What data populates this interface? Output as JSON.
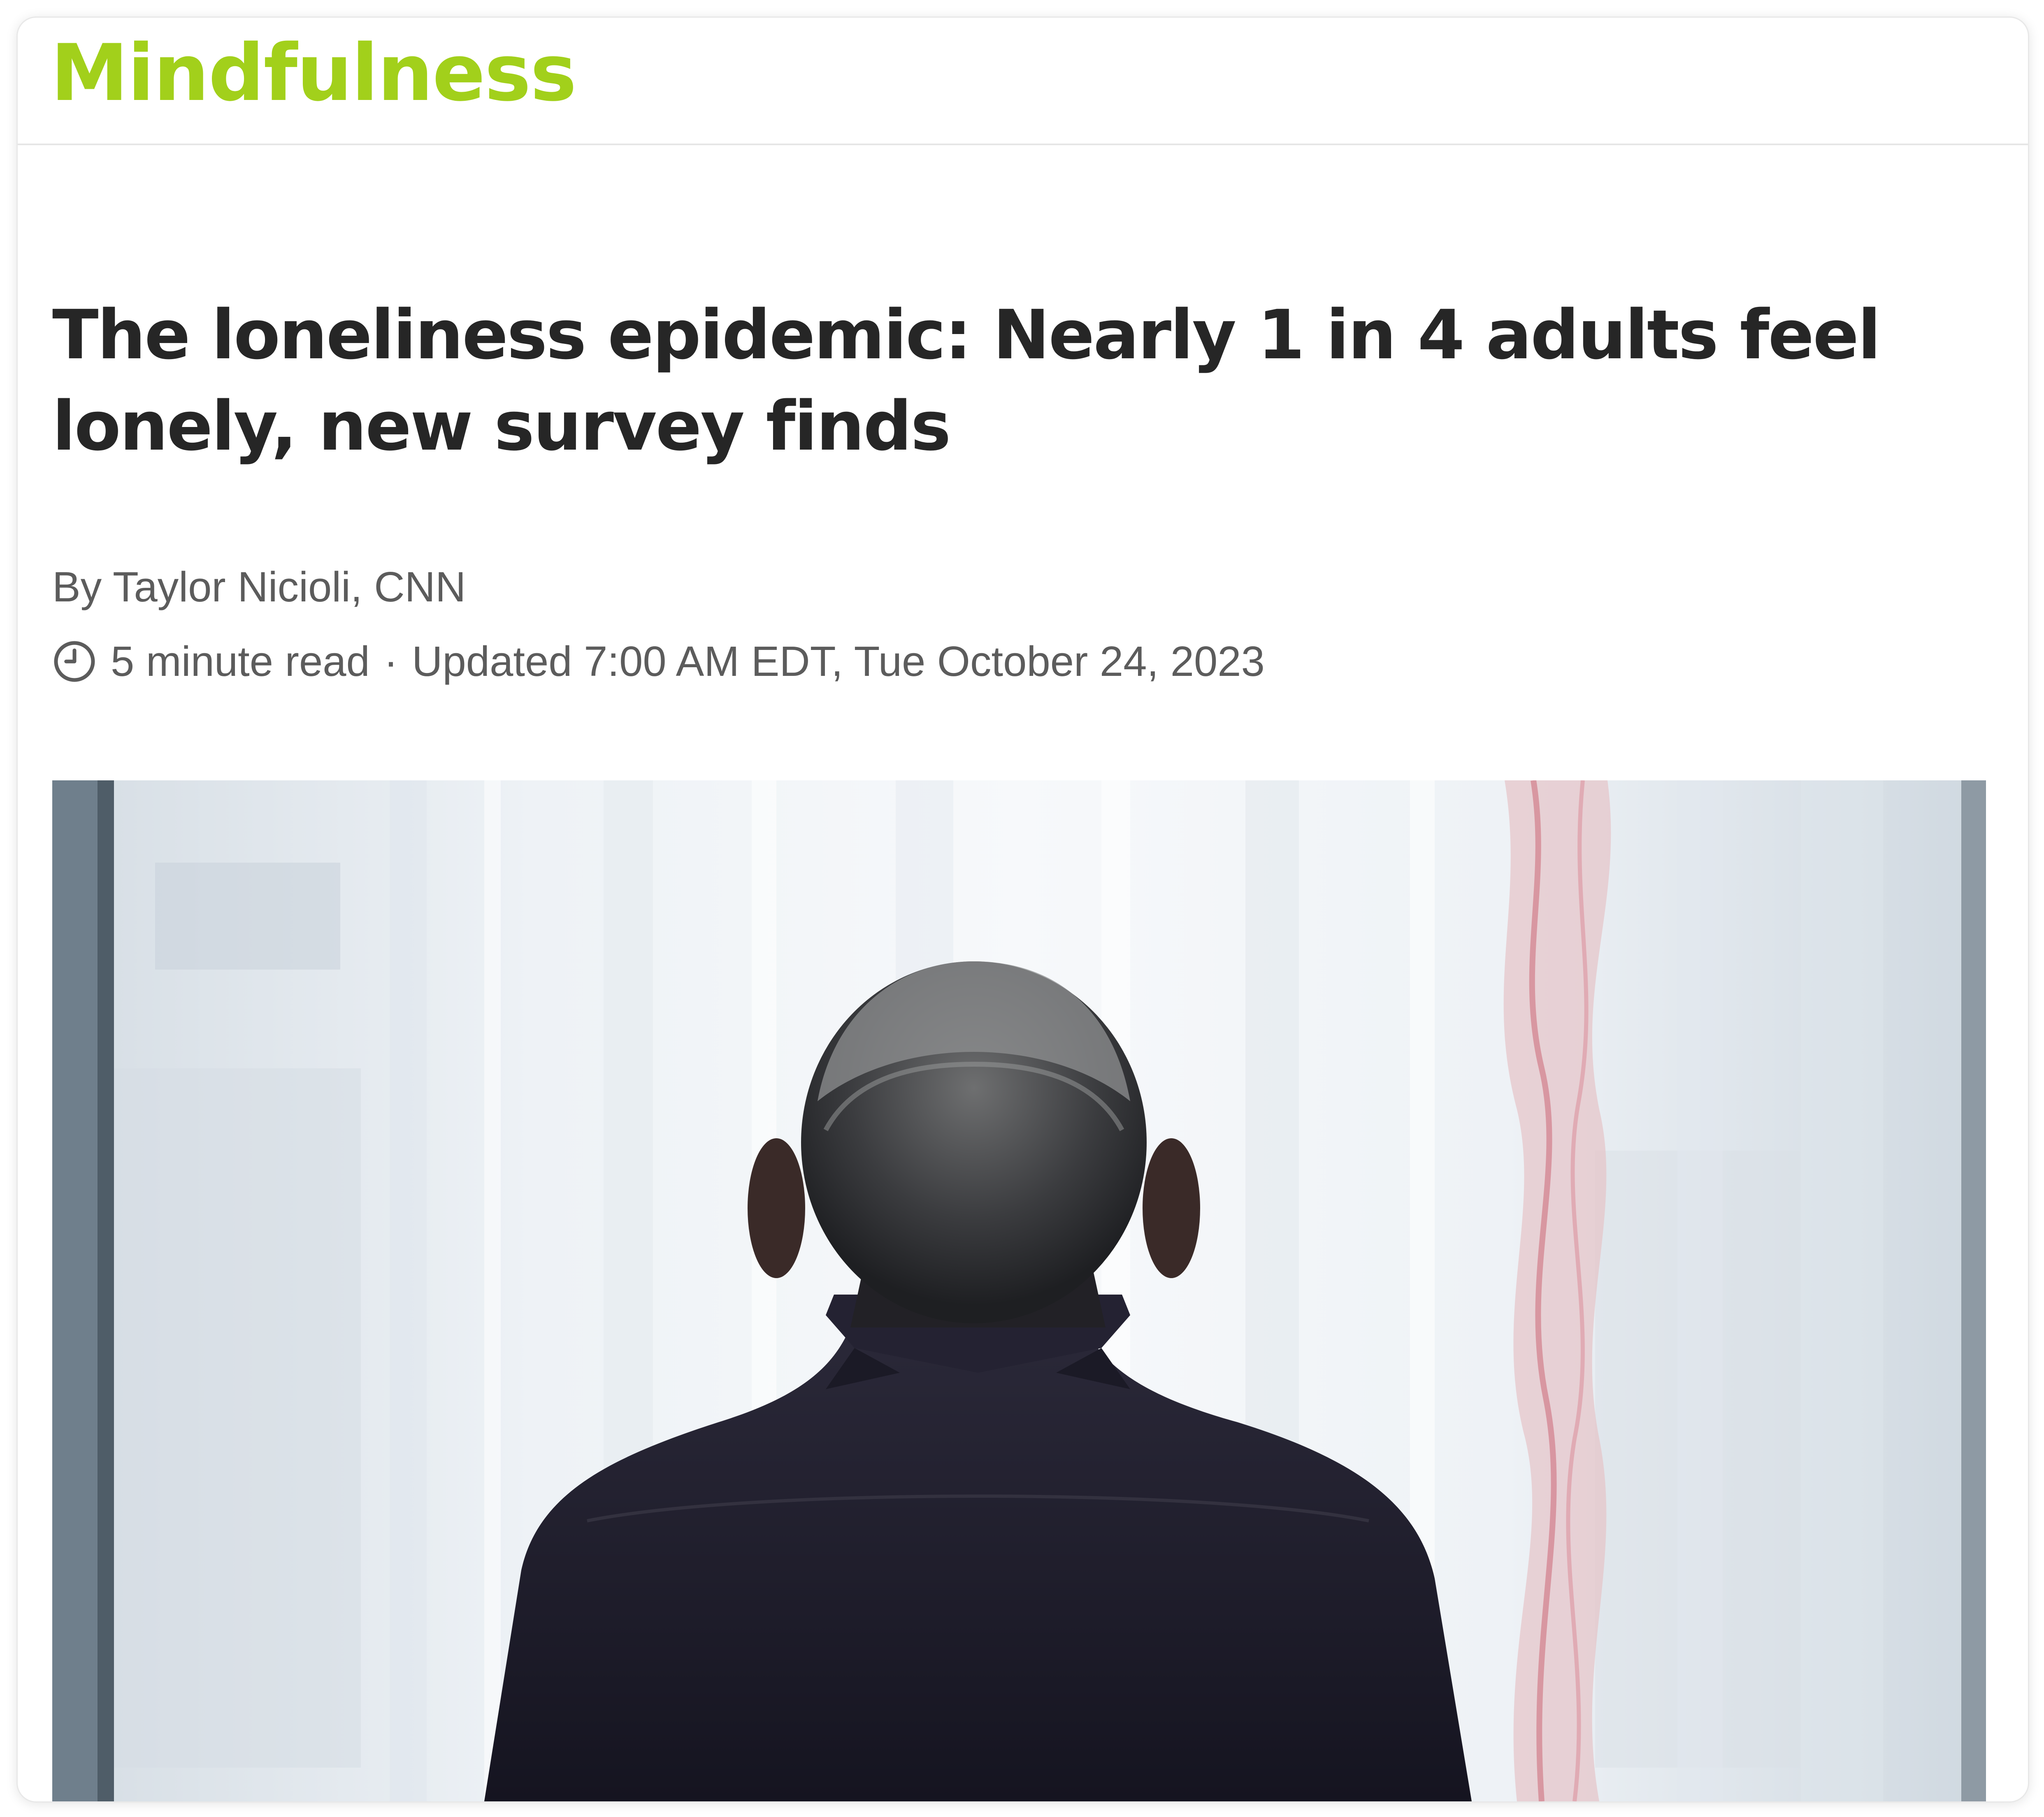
{
  "section": {
    "name": "Mindfulness",
    "accent_color": "#a2d01b"
  },
  "article": {
    "headline": "The loneliness epidemic: Nearly 1 in 4 adults feel lonely, new survey finds",
    "byline": "By Taylor Nicioli, CNN",
    "read_time": "5 minute read",
    "separator": "·",
    "updated": "Updated 7:00 AM EDT, Tue October 24, 2023",
    "read_time_icon": "clock-icon"
  },
  "hero_image": {
    "icon": "photo"
  }
}
